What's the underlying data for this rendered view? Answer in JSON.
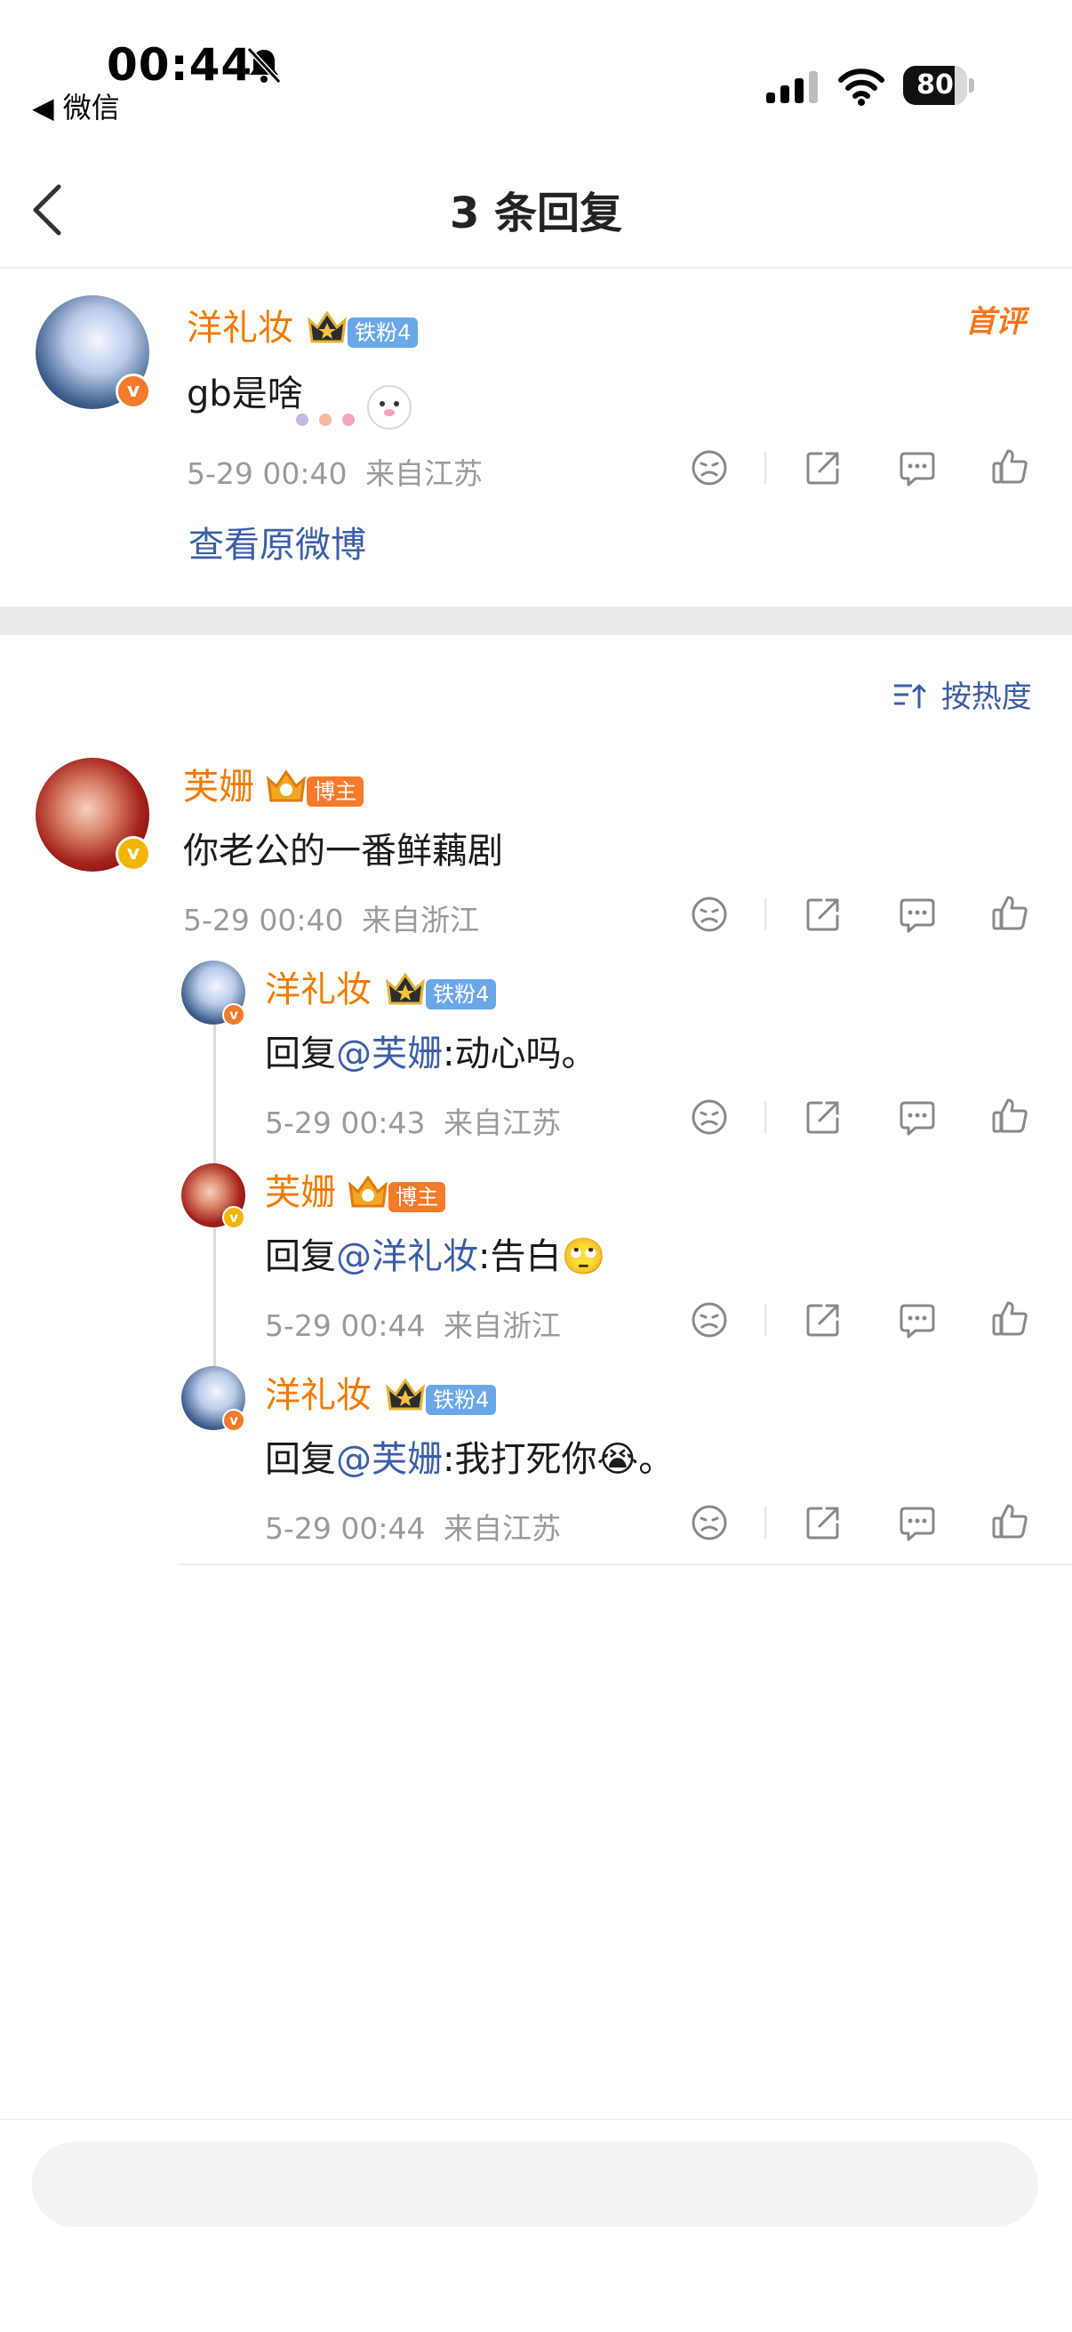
{
  "status_bar": {
    "time": "00:44",
    "back_app": "◀ 微信",
    "battery": "80"
  },
  "nav": {
    "title": "3 条回复"
  },
  "main_comment": {
    "name": "洋礼妆",
    "badge": "铁粉4",
    "tag": "首评",
    "text": "gb是啥",
    "time": "5-29 00:40",
    "location": "来自江苏",
    "view_original": "查看原微博"
  },
  "sort": {
    "label": "按热度"
  },
  "replies": [
    {
      "name": "芙姗",
      "badge": "博主",
      "text": "你老公的一番鲜藕剧",
      "time": "5-29 00:40",
      "location": "来自浙江"
    },
    {
      "name": "洋礼妆",
      "badge": "铁粉4",
      "prefix": "回复",
      "mention": "@芙姗",
      "body": ":动心吗。",
      "emoji": "",
      "suffix": "",
      "time": "5-29 00:43",
      "location": "来自江苏"
    },
    {
      "name": "芙姗",
      "badge": "博主",
      "prefix": "回复",
      "mention": "@洋礼妆",
      "body": ":告白",
      "emoji": "🙄",
      "suffix": "",
      "time": "5-29 00:44",
      "location": "来自浙江"
    },
    {
      "name": "洋礼妆",
      "badge": "铁粉4",
      "prefix": "回复",
      "mention": "@芙姗",
      "body": ":我打死你",
      "emoji": "😭",
      "suffix": "。",
      "time": "5-29 00:44",
      "location": "来自江苏"
    }
  ],
  "colors": {
    "name": "#f07b00",
    "link": "#3b5ea8",
    "meta": "#9a9a9a"
  }
}
